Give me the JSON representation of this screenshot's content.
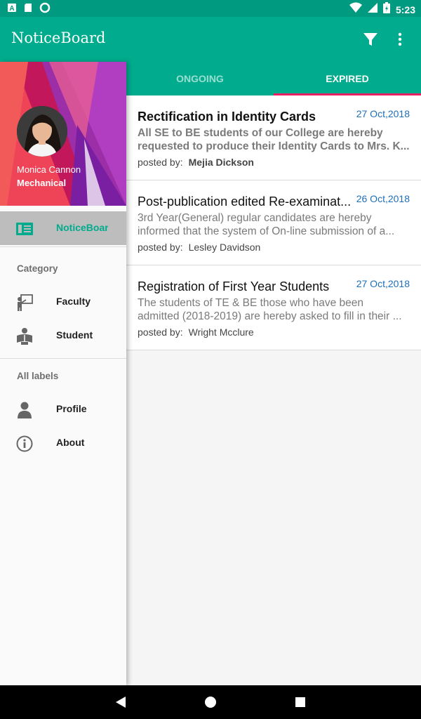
{
  "status_bar": {
    "time": "5:23"
  },
  "app_bar": {
    "title": "NoticeBoard",
    "filter_icon": "filter-icon",
    "menu_icon": "more-vert-icon"
  },
  "tabs": [
    {
      "label": "ONGOING",
      "selected": false
    },
    {
      "label": "EXPIRED",
      "selected": true
    }
  ],
  "notices": [
    {
      "title": "Rectification in  Identity Cards",
      "date": "27 Oct,2018",
      "body_line1": "All SE to BE students of our College are hereby",
      "body_line2": "requested to produce their Identity Cards to   Mrs. K...",
      "posted_by_label": "posted by:",
      "author": "Mejia Dickson"
    },
    {
      "title": "Post-publication  edited Re-examinat...",
      "date": "26 Oct,2018",
      "body_line1": "3rd Year(General) regular  candidates are hereby",
      "body_line2": "informed that the system of   On-line submission of a...",
      "posted_by_label": "posted by:",
      "author": "Lesley Davidson"
    },
    {
      "title": "Registration of  First Year Students",
      "date": "27 Oct,2018",
      "body_line1": "The students of TE & BE those who have been",
      "body_line2": "admitted (2018-2019) are hereby asked to fill  in their ...",
      "posted_by_label": "posted by:",
      "author": "Wright Mcclure"
    }
  ],
  "drawer": {
    "user_name": "Monica Cannon",
    "user_branch": "Mechanical",
    "active_item": "NoticeBoar",
    "category_label": "Category",
    "category_items": [
      {
        "label": "Faculty",
        "icon": "teacher-board-icon"
      },
      {
        "label": "Student",
        "icon": "student-reading-icon"
      }
    ],
    "all_labels_label": "All labels",
    "label_items": [
      {
        "label": "Profile",
        "icon": "person-icon"
      },
      {
        "label": "About",
        "icon": "info-icon"
      }
    ]
  },
  "colors": {
    "primary": "#00ac8d",
    "primary_dark": "#009a80",
    "tab_indicator": "#e91e63",
    "date_text": "#1e6fb8"
  }
}
